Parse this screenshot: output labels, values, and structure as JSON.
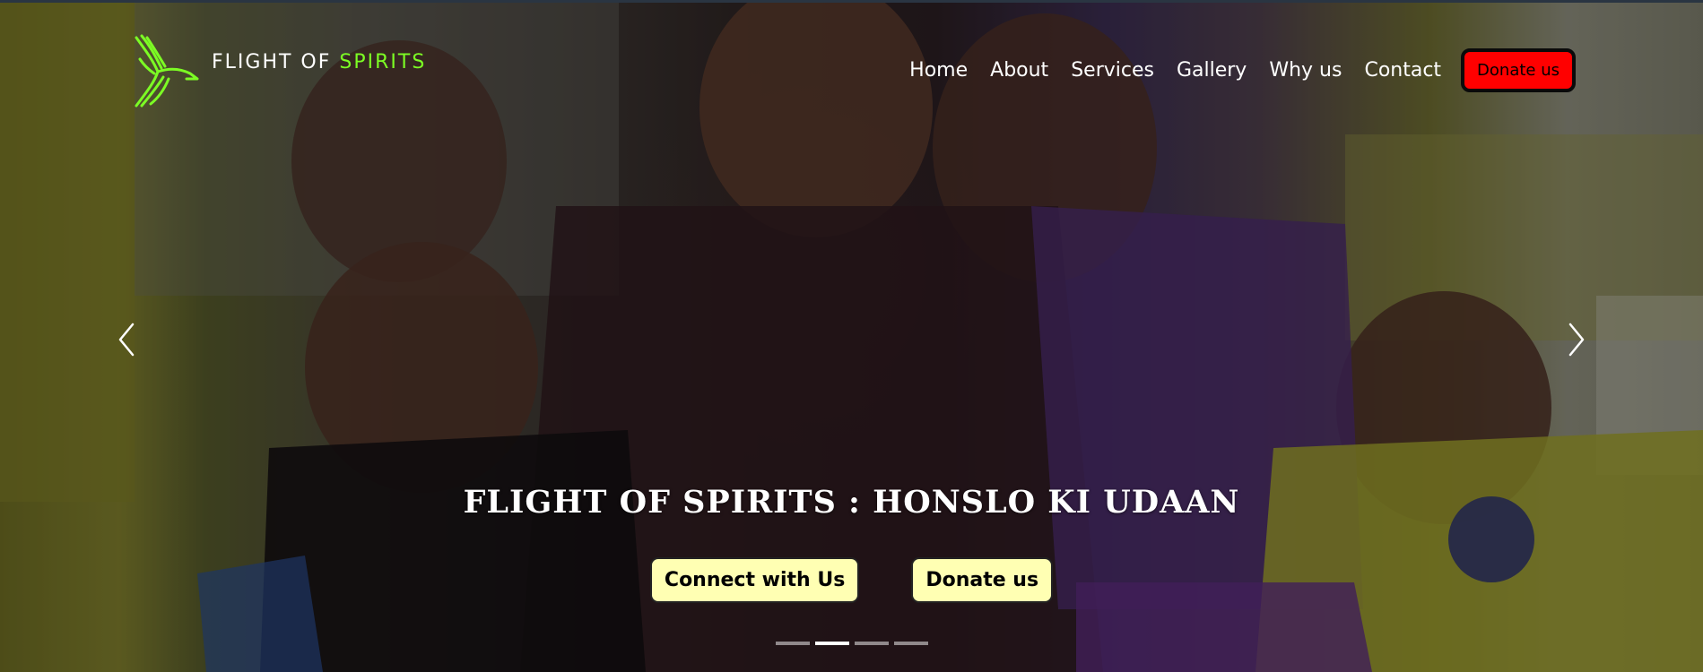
{
  "brand": {
    "name_part1": "FLIGHT OF ",
    "name_part2": "SPIRITS",
    "logo_icon": "bird-icon",
    "accent_color": "#7cfc24"
  },
  "nav": {
    "items": [
      {
        "label": "Home"
      },
      {
        "label": "About"
      },
      {
        "label": "Services"
      },
      {
        "label": "Gallery"
      },
      {
        "label": "Why us"
      },
      {
        "label": "Contact"
      }
    ],
    "donate_label": "Donate us",
    "donate_color": "#ff0000"
  },
  "carousel": {
    "caption": "FLIGHT OF SPIRITS : HONSLO KI UDAAN",
    "buttons": {
      "connect_label": "Connect with Us",
      "donate_label": "Donate us",
      "button_color": "#ffffb3"
    },
    "prev_icon": "chevron-left-icon",
    "next_icon": "chevron-right-icon",
    "slide_count": 4,
    "active_slide": 2
  }
}
